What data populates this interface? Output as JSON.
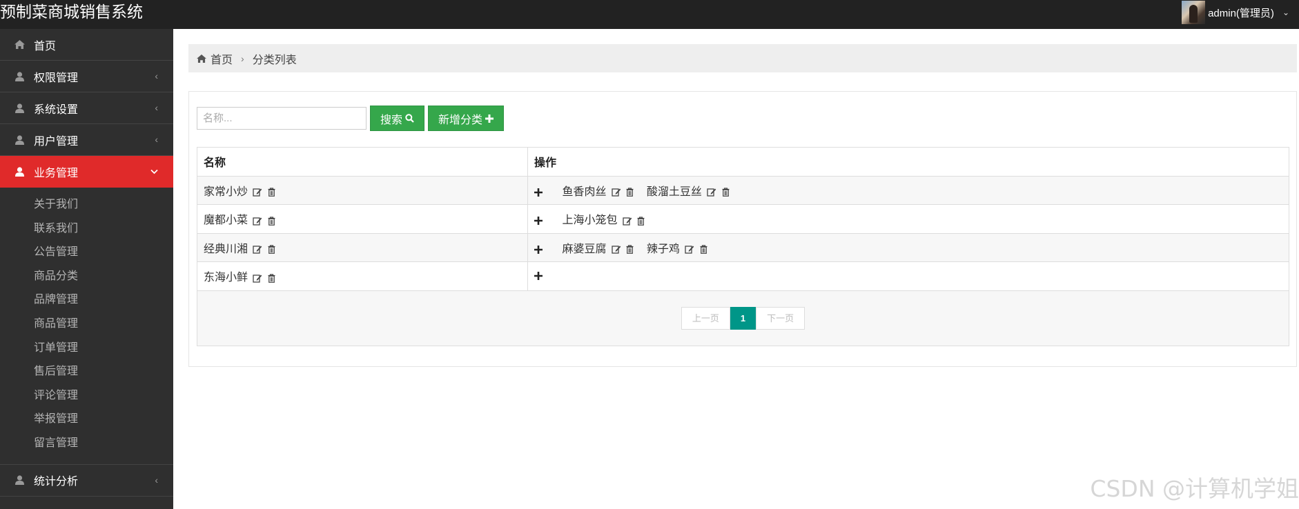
{
  "app": {
    "title": "预制菜商城销售系统"
  },
  "user": {
    "name": "admin(管理员)"
  },
  "sidebar": {
    "items": [
      {
        "label": "首页",
        "icon": "home-icon"
      },
      {
        "label": "权限管理",
        "icon": "user-icon"
      },
      {
        "label": "系统设置",
        "icon": "user-icon"
      },
      {
        "label": "用户管理",
        "icon": "user-icon"
      },
      {
        "label": "业务管理",
        "icon": "user-icon",
        "active": true
      },
      {
        "label": "统计分析",
        "icon": "user-icon"
      }
    ],
    "submenu": [
      "关于我们",
      "联系我们",
      "公告管理",
      "商品分类",
      "品牌管理",
      "商品管理",
      "订单管理",
      "售后管理",
      "评论管理",
      "举报管理",
      "留言管理"
    ]
  },
  "breadcrumb": {
    "home": "首页",
    "current": "分类列表"
  },
  "toolbar": {
    "search_placeholder": "名称...",
    "search_label": "搜索",
    "add_label": "新增分类"
  },
  "table": {
    "headers": [
      "名称",
      "操作"
    ],
    "rows": [
      {
        "name": "家常小炒",
        "children": [
          "鱼香肉丝",
          "酸溜土豆丝"
        ]
      },
      {
        "name": "魔都小菜",
        "children": [
          "上海小笼包"
        ]
      },
      {
        "name": "经典川湘",
        "children": [
          "麻婆豆腐",
          "辣子鸡"
        ]
      },
      {
        "name": "东海小鲜",
        "children": []
      }
    ]
  },
  "pager": {
    "prev": "上一页",
    "current": "1",
    "next": "下一页"
  },
  "watermark": "CSDN @计算机学姐",
  "colors": {
    "topbar": "#222222",
    "sidebar": "#2f2f2f",
    "active": "#e02a2a",
    "button": "#35a74b",
    "page_current": "#009688"
  }
}
